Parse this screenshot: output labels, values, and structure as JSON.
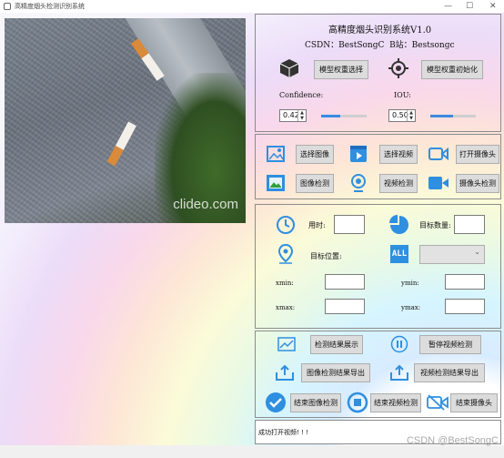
{
  "window": {
    "title": "高精度烟头检测识别系统",
    "controls": [
      "—",
      "☐",
      "✕"
    ]
  },
  "preview": {
    "watermark": "clideo.com"
  },
  "header": {
    "title": "高精度烟头识别系统V1.0",
    "subtitle": "CSDN：BestSongC  B站：Bestsongc"
  },
  "model": {
    "select_weights_label": "模型权重选择",
    "init_weights_label": "模型权重初始化",
    "confidence_label": "Confidence:",
    "confidence_value": "0.42",
    "confidence_level": 0.42,
    "iou_label": "IOU:",
    "iou_value": "0.50",
    "iou_level": 0.5
  },
  "source": {
    "select_image_label": "选择图像",
    "select_video_label": "选择视频",
    "open_camera_label": "打开摄像头",
    "detect_image_label": "图像检测",
    "detect_video_label": "视频检测",
    "detect_camera_label": "摄像头检测"
  },
  "results": {
    "time_label": "用时:",
    "time_value": "",
    "count_label": "目标数量:",
    "count_value": "",
    "position_label": "目标位置:",
    "target_select_value": "",
    "xmin_label": "xmin:",
    "xmin_value": "",
    "ymin_label": "ymin:",
    "ymin_value": "",
    "xmax_label": "xmax:",
    "xmax_value": "",
    "ymax_label": "ymax:",
    "ymax_value": "",
    "all_badge": "ALL"
  },
  "actions": {
    "show_results_label": "检测结果展示",
    "pause_video_label": "暂停视频检测",
    "export_image_label": "图像检测结果导出",
    "export_video_label": "视频检测结果导出",
    "end_image_label": "结束图像检测",
    "end_video_label": "结束视频检测",
    "end_camera_label": "结束摄像头"
  },
  "log": {
    "message": "成功打开视频! ! !"
  },
  "overlay": {
    "csdn_watermark": "CSDN @BestSongC"
  },
  "colors": {
    "icon_blue": "#2f8fe0",
    "slider_blue": "#3b8be0",
    "button_gray": "#dcdcdc"
  }
}
